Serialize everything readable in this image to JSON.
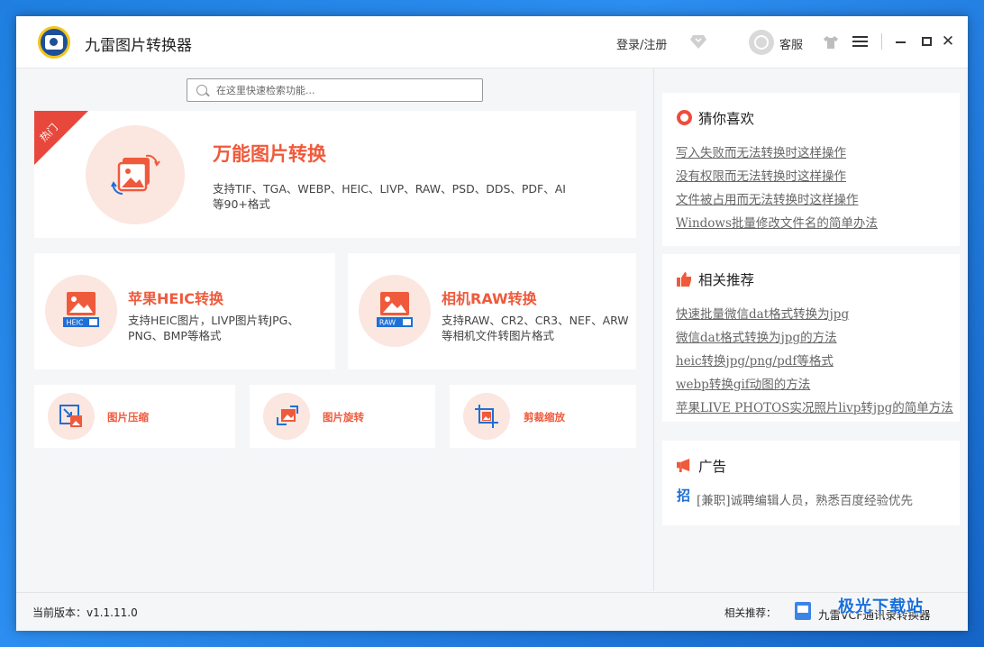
{
  "window": {
    "title": "九雷图片转换器",
    "login_label": "登录/注册",
    "service_label": "客服"
  },
  "search": {
    "placeholder": "在这里快速检索功能..."
  },
  "hero": {
    "badge": "热门",
    "title": "万能图片转换",
    "desc": "支持TIF、TGA、WEBP、HEIC、LIVP、RAW、PSD、DDS、PDF、AI等90+格式"
  },
  "heic": {
    "title": "苹果HEIC转换",
    "desc": "支持HEIC图片，LIVP图片转JPG、PNG、BMP等格式",
    "icon_tag": "HEIC"
  },
  "raw": {
    "title": "相机RAW转换",
    "desc": "支持RAW、CR2、CR3、NEF、ARW等相机文件转图片格式",
    "icon_tag": "RAW"
  },
  "tools": [
    {
      "label": "图片压缩",
      "icon": "compress-icon"
    },
    {
      "label": "图片旋转",
      "icon": "rotate-icon"
    },
    {
      "label": "剪裁缩放",
      "icon": "crop-icon"
    }
  ],
  "panels": {
    "guess": {
      "title": "猜你喜欢",
      "links": [
        "写入失败而无法转换时这样操作",
        "没有权限而无法转换时这样操作",
        "文件被占用而无法转换时这样操作",
        "Windows批量修改文件名的简单办法"
      ]
    },
    "related": {
      "title": "相关推荐",
      "links": [
        "快速批量微信dat格式转换为jpg",
        "微信dat格式转换为jpg的方法",
        "heic转换jpg/png/pdf等格式",
        "webp转换gif动图的方法",
        "苹果LIVE PHOTOS实况照片livp转jpg的简单方法"
      ]
    },
    "ads": {
      "title": "广告",
      "badge": "招",
      "text": "[兼职]诚聘编辑人员，熟悉百度经验优先"
    }
  },
  "statusbar": {
    "version": "当前版本：v1.1.11.0",
    "rec_label": "相关推荐：",
    "rec_link": "九雷VCF通讯录转换器"
  },
  "watermark": "极光下载站",
  "colors": {
    "accent": "#ef5a3c",
    "hot": "#e8483c",
    "circle": "#fbe6e0"
  }
}
